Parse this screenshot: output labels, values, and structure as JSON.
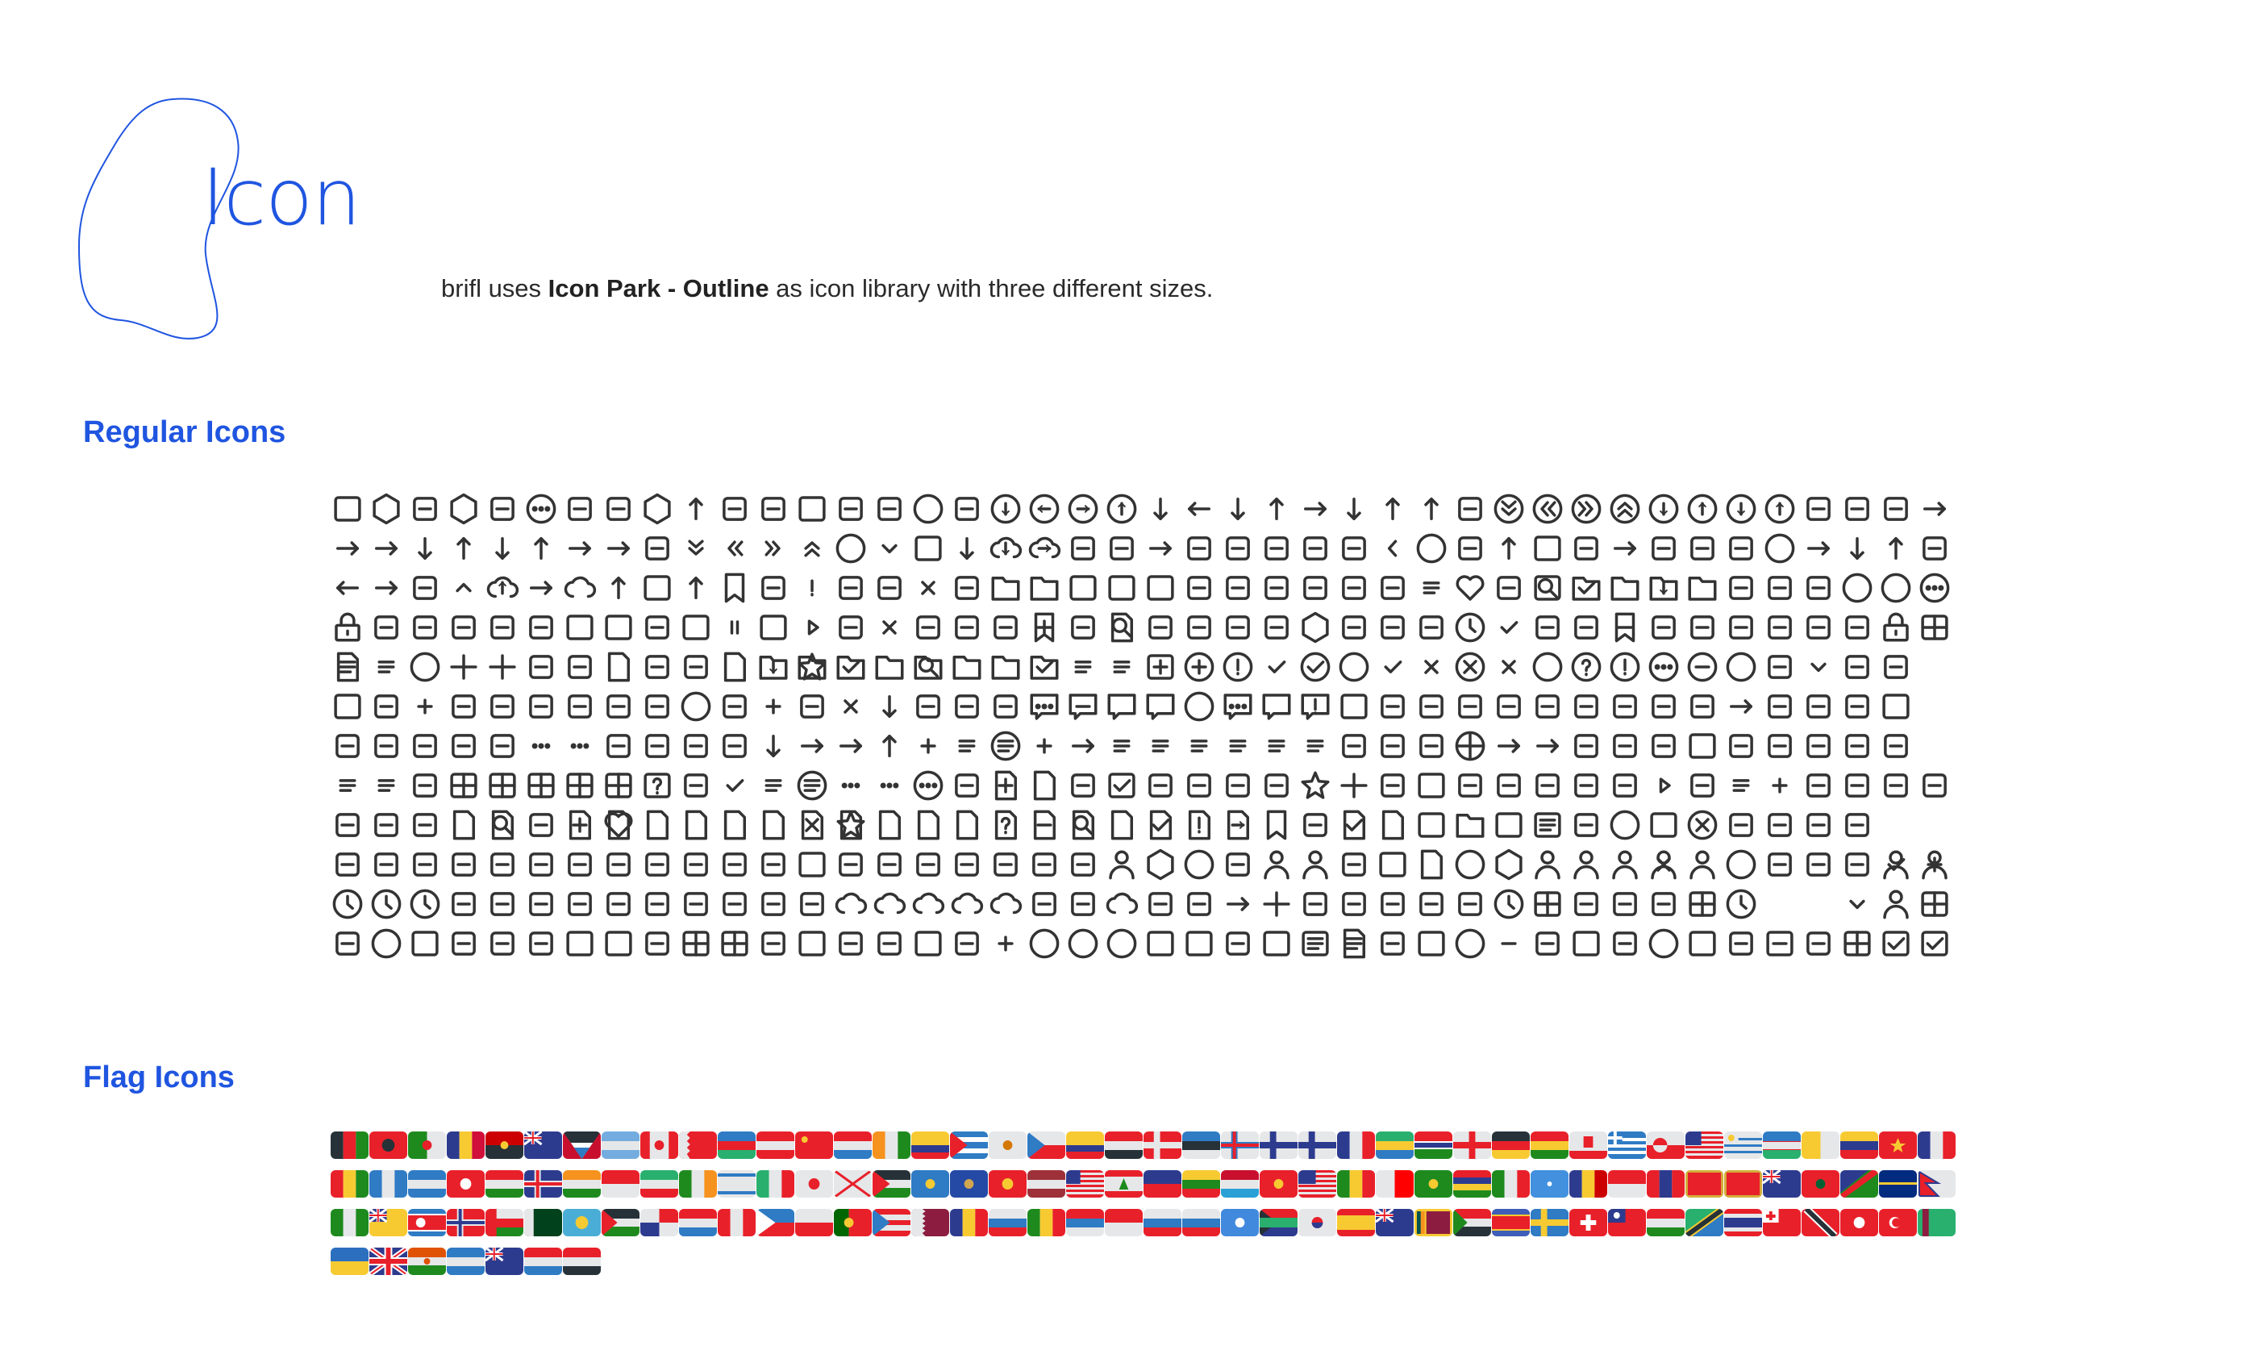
{
  "header": {
    "title": "Icon",
    "description_prefix": "brifl uses ",
    "description_bold": "Icon Park - Outline",
    "description_suffix": " as icon library with three different sizes.",
    "accent_color": "#1f55e0"
  },
  "regular_icons": {
    "heading": "Regular Icons",
    "icon_color": "#333333",
    "rows": [
      [
        "box",
        "cube-twist",
        "book-open",
        "hexagon-y",
        "qr-code",
        "dots-circle",
        "triangle-nodes",
        "infinity",
        "shield-hex",
        "upload-arc",
        "clover",
        "asterisk",
        "cube-frame",
        "nodes",
        "atom",
        "globe",
        "orbit",
        "arrow-circle-down",
        "arrow-circle-left",
        "arrow-circle-right",
        "arrow-circle-up",
        "arrow-down",
        "arrow-left",
        "arrow-down-left",
        "arrow-up-left",
        "arrow-right",
        "arrow-down-right",
        "arrow-up-right",
        "arrow-up",
        "transfer",
        "circle-double-down",
        "circle-double-left",
        "circle-double-right",
        "circle-double-up",
        "arrow-circle-down-left",
        "arrow-circle-up-left",
        "arrow-circle-down-right",
        "arrow-circle-up-right",
        "collapse",
        "corner-expand",
        "loop",
        "send"
      ],
      [
        "enter",
        "return-right",
        "turn-down-left",
        "turn-up-left",
        "turn-down-right",
        "turn-up-right",
        "back",
        "forward",
        "refresh-rotate",
        "double-down",
        "double-left",
        "double-right",
        "double-up",
        "circle-down",
        "down-small",
        "square-down",
        "download",
        "cloud-download",
        "cloud-arrow",
        "corner",
        "collapse-up",
        "to-bottom",
        "expand",
        "fullscreen",
        "right-bar",
        "left-bar",
        "switch",
        "left-small",
        "circle-left",
        "left",
        "arrow-left-up",
        "square-left",
        "logout",
        "center",
        "rotate-right",
        "exchange",
        "right",
        "circle-right",
        "arrow-right-small",
        "arrow-down-right-small",
        "arrow-up-right-small",
        "sort"
      ],
      [
        "to-left",
        "to-right",
        "undo",
        "up-small",
        "cloud-upload",
        "to-top",
        "cloud-up",
        "upload",
        "square-up",
        "arrow-up-small",
        "bookmark-stack",
        "bug",
        "warning",
        "edit-corner",
        "compass-draw",
        "delete",
        "command",
        "inbox-in",
        "inbox-down",
        "right-panel",
        "left-panel",
        "top-panel",
        "experiment",
        "female",
        "filter",
        "bottle",
        "gift",
        "shapes",
        "menu",
        "heart",
        "lightning",
        "calendar-search",
        "inbox-check",
        "inbox-up",
        "inbox-download",
        "inbox",
        "scale",
        "home",
        "attachment",
        "loading-ring",
        "loading-arc",
        "loading-dots"
      ],
      [
        "lock",
        "mail",
        "mail-edit",
        "mail-open",
        "male",
        "mirror",
        "video",
        "video-off",
        "diamond",
        "layout",
        "pause",
        "image",
        "play",
        "hash",
        "eye-closed",
        "eye",
        "umbrella-small",
        "puzzle",
        "bookmark-add",
        "save",
        "search-doc",
        "adjust",
        "setting",
        "sun",
        "share",
        "shield",
        "shopping-bag",
        "cart",
        "presentation",
        "stopwatch",
        "badge-check",
        "lamp",
        "tag",
        "bookmark-minus",
        "terminal",
        "trophy",
        "trophy-alt",
        "signal-off",
        "shop",
        "umbrella",
        "unlock",
        "app-grid"
      ],
      [
        "news",
        "list-view",
        "radio",
        "grid-small",
        "grid-tall",
        "ring",
        "book",
        "notebook",
        "book-opened",
        "sheets",
        "clipboard",
        "folder-download",
        "folder-star",
        "folder-check",
        "folder-fav",
        "folder-search",
        "archive-down",
        "archive",
        "archive-check",
        "list-number",
        "list-bullets",
        "square-plus",
        "circle-plus",
        "circle-alert",
        "check",
        "circle-check",
        "loading-c",
        "check-small",
        "close",
        "circle-close",
        "close-small",
        "registered",
        "circle-help",
        "circle-info",
        "circle-more",
        "circle-minus",
        "trademark",
        "down-line",
        "down-small-line",
        "up-down",
        "exchange-alt",
        "spacer"
      ],
      [
        "chart-line-window",
        "chart-zig",
        "calculator-plus",
        "calculator-ops",
        "chart-bell",
        "scatter-nodes",
        "bar-chart",
        "line-chart",
        "pie-donut",
        "target",
        "dot-chart",
        "add-down",
        "database",
        "delete-down",
        "import-down",
        "bell-curve",
        "pie-chart",
        "signal",
        "message-dots",
        "message-minus",
        "messages",
        "message-lines",
        "message-smile",
        "comment-dots",
        "comment-edit",
        "comment-info",
        "bezier-box",
        "bezier",
        "curve",
        "route",
        "track",
        "hierarchy",
        "branch",
        "waves-link",
        "command-key",
        "anchor",
        "turn-path",
        "connection",
        "organization",
        "s-path",
        "copy-square",
        "spacer"
      ],
      [
        "bracket-right",
        "link",
        "copy-move",
        "copy",
        "car-like",
        "dots-ring",
        "dots-ring-alt",
        "share-nodes",
        "split-down",
        "merge-down",
        "node-tree",
        "u-turn-down",
        "return-loop",
        "back-loop",
        "u-turn-up",
        "focus-plus",
        "text-size",
        "circle-text",
        "dashed-plus",
        "align-center",
        "align-left-bar",
        "align-left",
        "align-justify",
        "align-right",
        "align-right-short",
        "align-vertical",
        "compress",
        "sort-az",
        "sort-za",
        "grid-circles",
        "expand-vertical",
        "expand-horizontal",
        "fit-width",
        "reply",
        "brightness",
        "calendar",
        "eraser",
        "code",
        "column",
        "copy-stack",
        "trash-can",
        "spacer"
      ],
      [
        "search-list",
        "text",
        "sum",
        "table-small",
        "table",
        "table-big",
        "table-header",
        "table-four",
        "help-box",
        "link-chain",
        "list-check",
        "list-dot",
        "list-circle",
        "more-horizontal",
        "more-vertical",
        "circle-more-horizontal",
        "cursor",
        "doc-add",
        "image-file",
        "undo-arc",
        "calendar-check",
        "number",
        "triangle-ruler",
        "copy-corner",
        "scan",
        "star",
        "grid-qr",
        "pencil",
        "card",
        "gem",
        "percentage",
        "barcode",
        "scan-code",
        "wave-bars",
        "play-record",
        "bell-off",
        "music-list",
        "playlist-add",
        "podcast",
        "mic",
        "mic-off",
        "volume-down"
      ],
      [
        "volume-up",
        "equalizer",
        "voice",
        "file-bookmark",
        "file-search",
        "venn",
        "file-add",
        "file-heart",
        "file-transfer",
        "file-time",
        "file-eye",
        "file-edit",
        "file-close",
        "file-star",
        "file-hash",
        "file-hide",
        "file-lock",
        "file-question",
        "file-minus",
        "file-search-alt",
        "file-user",
        "file-check",
        "file-warning",
        "file-return",
        "bookmark-empty",
        "paperclip",
        "doc-check",
        "doc-chart",
        "card-id",
        "folder-open",
        "box-open",
        "text-frame",
        "dice",
        "circle-stop",
        "square-stop",
        "circle-x",
        "pin",
        "magic",
        "loader",
        "camera-focus",
        "spacer",
        "spacer"
      ],
      [
        "battery-full",
        "battery-half",
        "cast",
        "graduation",
        "flag",
        "leaf",
        "hourglass",
        "location-pin",
        "location-flag",
        "map-pin",
        "map",
        "road",
        "slash-frame",
        "waves",
        "sprout",
        "speaker",
        "projector",
        "toggle",
        "translate",
        "truck",
        "triangle-person",
        "cube-3d",
        "earth",
        "pulse",
        "user-stand",
        "child",
        "shirt",
        "id-card",
        "doc-person",
        "user-circle",
        "user-shield",
        "user-scan",
        "user-face",
        "user-badge",
        "user-x",
        "user-focus",
        "emoji-smile",
        "medal",
        "rocket",
        "chess",
        "user-check",
        "user-plus"
      ],
      [
        "history",
        "timer-half",
        "clock",
        "cocktail",
        "ship",
        "train",
        "beach",
        "gear-sun",
        "bus",
        "cable-car",
        "balloon",
        "airplane",
        "luggage",
        "cloud-fog",
        "cloud-rain",
        "cloud-wind",
        "cloud-drizzle",
        "cloud-snow",
        "snowflake",
        "sunny",
        "cloud-thunder",
        "wind",
        "switch-vertical",
        "expand-arrows",
        "view-grid",
        "pen",
        "volume-loud",
        "volume-mid",
        "battery-charge",
        "battery-empty",
        "stopwatch-alt",
        "calendar-grid",
        "compass-cross",
        "scissors",
        "volume-mute",
        "apps",
        "alarm",
        "spacer",
        "spacer",
        "chevron-down",
        "user",
        "tablet"
      ],
      [
        "behance",
        "dribbble",
        "instagram",
        "paypal",
        "twitter",
        "tiktok",
        "windows",
        "sketch",
        "android",
        "appstore",
        "apple",
        "facebook",
        "dropbox",
        "evernote",
        "linkedin",
        "split-layout",
        "github",
        "plus",
        "sad",
        "neutral",
        "smile",
        "phone",
        "monitor",
        "disk",
        "square",
        "text-box",
        "doc-text",
        "number-eight",
        "percent-box",
        "circle-ring",
        "minus-pill",
        "hand",
        "layout-alt",
        "move",
        "loading-sun",
        "hashtag-box",
        "toggles",
        "minus-box",
        "width",
        "clapperboard",
        "checkbox",
        "list-check-box"
      ]
    ]
  },
  "flag_icons": {
    "heading": "Flag Icons",
    "rows": [
      [
        "af",
        "al",
        "dz",
        "ad",
        "ao",
        "ai",
        "ag",
        "ar",
        "ca",
        "bh",
        "az",
        "at",
        "cn",
        "hr",
        "ci",
        "co",
        "cu",
        "cy",
        "cz",
        "ec",
        "eg",
        "dk",
        "ee",
        "fo",
        "fi",
        "fi",
        "fr",
        "ga",
        "gm",
        "ge",
        "de",
        "gh",
        "gi",
        "gr",
        "gl",
        "us",
        "uy",
        "uz",
        "va",
        "ve",
        "vn",
        "fr"
      ],
      [
        "gn",
        "gt",
        "hn",
        "hk",
        "hu",
        "is",
        "in",
        "id",
        "ir",
        "ie",
        "il",
        "it",
        "jp",
        "je",
        "jo",
        "kz",
        "xk",
        "kg",
        "lv",
        "lr",
        "lb",
        "li",
        "lt",
        "lu",
        "mk",
        "my",
        "ml",
        "mt",
        "mr",
        "mu",
        "mx",
        "fm",
        "md",
        "mc",
        "mn",
        "me",
        "me",
        "ms",
        "ma",
        "na",
        "nr",
        "np"
      ],
      [
        "ng",
        "nu",
        "kp",
        "no",
        "om",
        "pk",
        "pw",
        "ps",
        "pa",
        "py",
        "pe",
        "ph",
        "pl",
        "pt",
        "pr",
        "qa",
        "ro",
        "ru",
        "sn",
        "rs",
        "sg",
        "sk",
        "si",
        "so",
        "za",
        "kr",
        "es",
        "sh",
        "lk",
        "sd",
        "sz",
        "se",
        "ch",
        "tw",
        "tj",
        "tz",
        "th",
        "to",
        "tt",
        "tn",
        "tr",
        "tm"
      ],
      [
        "ua",
        "gb",
        "ne",
        "ni",
        "nz",
        "nl",
        "ye"
      ]
    ]
  }
}
